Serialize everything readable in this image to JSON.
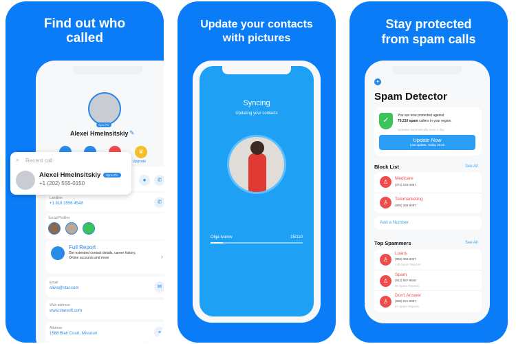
{
  "colors": {
    "brand_blue": "#0a7cf7",
    "screen_blue": "#1ea0f5",
    "spam_red": "#ef4b4b",
    "shield_green": "#3cc35a"
  },
  "panel1": {
    "headline": "Find out who\ncalled",
    "contact_name": "Alexei Hmelnsitskiy",
    "sync_badge": "Sync.Pic",
    "upgrade_label": "Upgrade",
    "recent_call": {
      "search_placeholder": "Recent call",
      "name": "Alexei Hmelnsitskiy",
      "badge": "Sync.Pic",
      "phone": "+1 (202) 555-0150"
    },
    "landline": {
      "label": "Landline",
      "value": "+1 818 3556 4548"
    },
    "social_label": "Social Profiles",
    "full_report": {
      "title": "Full Report",
      "desc": "Get extended contact details, career history, Online accounts and more"
    },
    "email": {
      "label": "Email",
      "value": "olivia@star.com"
    },
    "web": {
      "label": "Web address",
      "value": "www.starsoft.com"
    },
    "address": {
      "label": "Address",
      "value": "1588 Blair Court, Missouri"
    }
  },
  "panel2": {
    "headline": "Update your contacts\nwith pictures",
    "title": "Syncing",
    "subtitle": "Updating your contacts",
    "contact_name": "Olga Ivanov",
    "count": "15/110",
    "progress_fraction": 0.136
  },
  "panel3": {
    "headline": "Stay protected\nfrom spam calls",
    "title": "Spam Detector",
    "protected_text_1": "You are now protected against",
    "protected_count": "70,210 spam",
    "protected_text_2": "callers in your region.",
    "auto_update": "Updated automatically once a day",
    "update_button": "Update Now",
    "last_update": "Last update: Today 15:02",
    "block_list_title": "Block List",
    "see_all": "See All",
    "block_list": [
      {
        "name": "Medicare",
        "phone": "(072) 228-4867"
      },
      {
        "name": "Telemarketing",
        "phone": "(985) 358-8097"
      }
    ],
    "add_number": "Add a Number",
    "top_spammers_title": "Top Spammers",
    "top_spammers": [
      {
        "name": "Loans",
        "phone": "(985) 358-8097",
        "reports": "145 Spam Reports"
      },
      {
        "name": "Spam",
        "phone": "(912) 587-9648",
        "reports": "56 Spam Reports"
      },
      {
        "name": "Don't Answer",
        "phone": "(986) 021-6887",
        "reports": "87 Spam Reports"
      }
    ]
  }
}
